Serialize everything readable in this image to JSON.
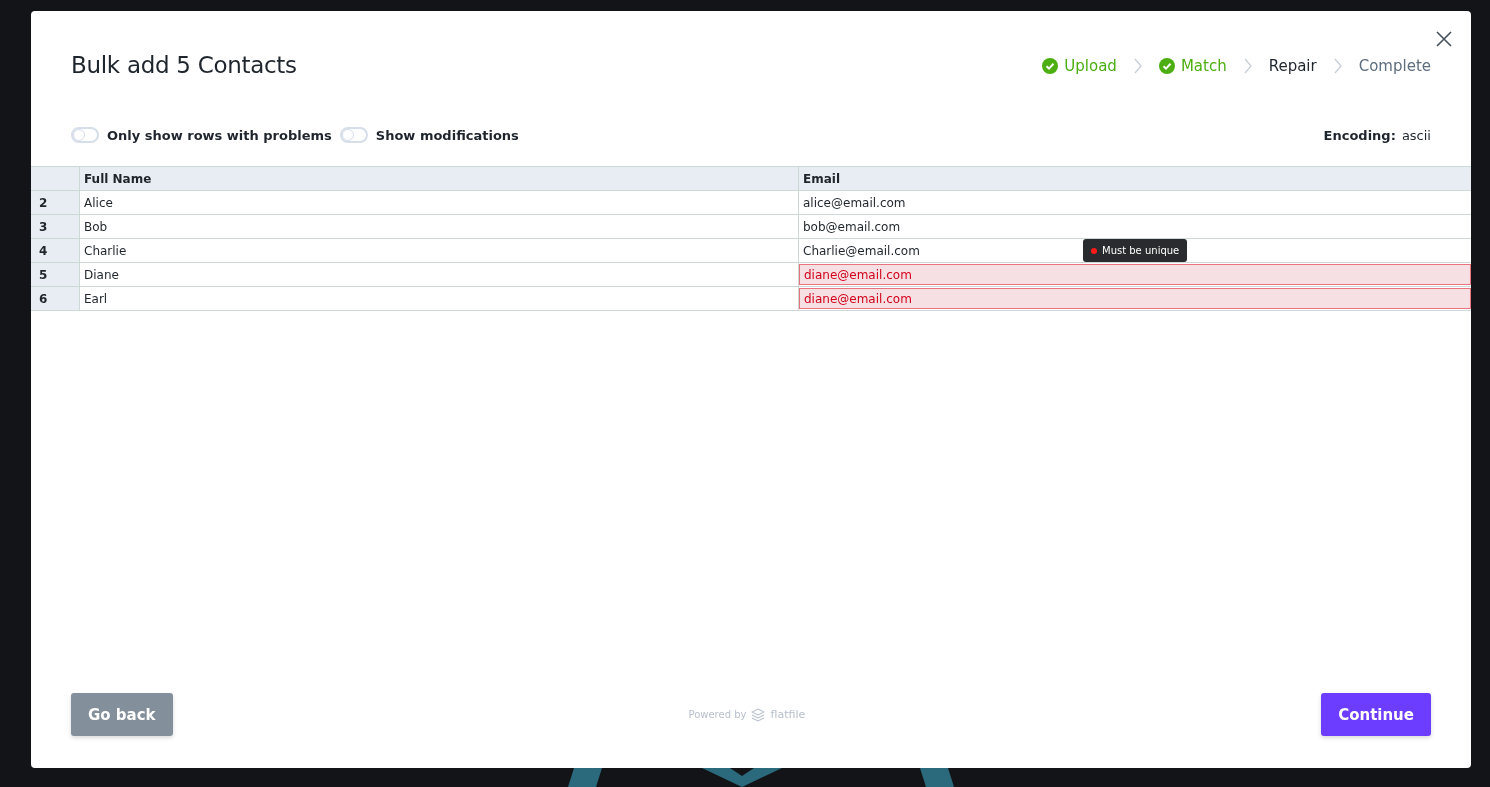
{
  "title": "Bulk add 5 Contacts",
  "steps": [
    {
      "label": "Upload",
      "kind": "done"
    },
    {
      "label": "Match",
      "kind": "done"
    },
    {
      "label": "Repair",
      "kind": "current"
    },
    {
      "label": "Complete",
      "kind": "pending"
    }
  ],
  "toggles": [
    {
      "label": "Only show rows with problems",
      "on": false
    },
    {
      "label": "Show modifications",
      "on": false
    }
  ],
  "encoding": {
    "label": "Encoding:",
    "value": "ascii"
  },
  "table": {
    "columns": [
      "Full Name",
      "Email"
    ],
    "rows": [
      {
        "number": "2",
        "name": "Alice",
        "email": "alice@email.com",
        "email_error": false
      },
      {
        "number": "3",
        "name": "Bob",
        "email": "bob@email.com",
        "email_error": false
      },
      {
        "number": "4",
        "name": "Charlie",
        "email": "Charlie@email.com",
        "email_error": false
      },
      {
        "number": "5",
        "name": "Diane",
        "email": "diane@email.com",
        "email_error": true,
        "tooltip": "Must be unique"
      },
      {
        "number": "6",
        "name": "Earl",
        "email": "diane@email.com",
        "email_error": true
      }
    ]
  },
  "footer": {
    "back": "Go back",
    "powered_by": "Powered by",
    "brand": "flatfile",
    "continue": "Continue"
  }
}
